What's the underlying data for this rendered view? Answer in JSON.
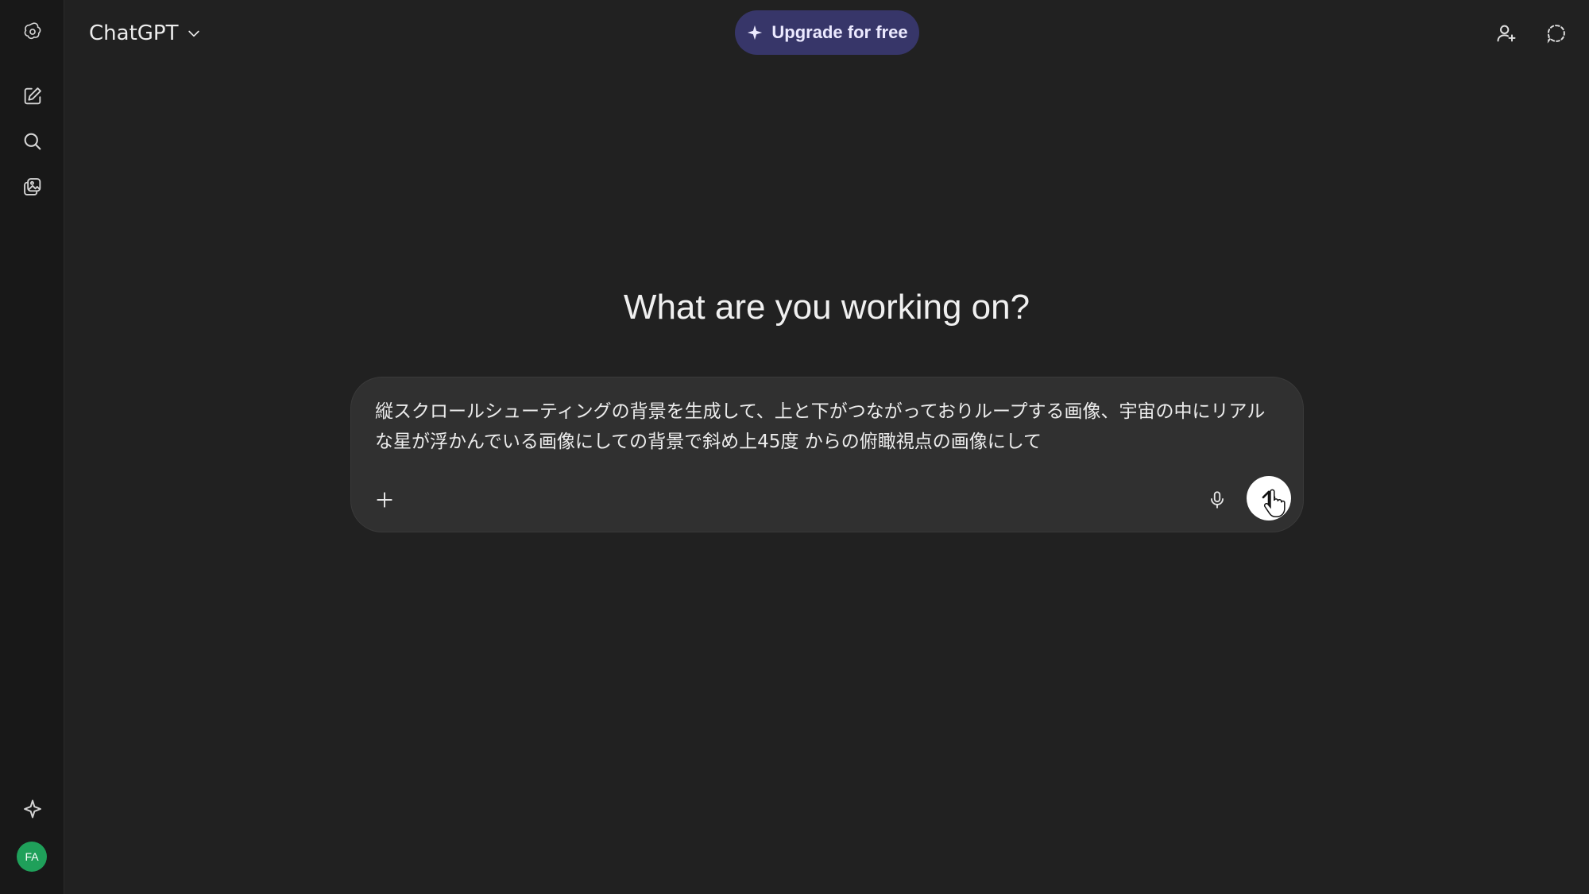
{
  "header": {
    "model_label": "ChatGPT",
    "upgrade_label": "Upgrade for free"
  },
  "main": {
    "headline": "What are you working on?",
    "prompt_text": "縦スクロールシューティングの背景を生成して、上と下がつながっておりループする画像、宇宙の中にリアルな星が浮かんでいる画像にしての背景で斜め上45度 からの俯瞰視点の画像にして"
  },
  "user": {
    "initials": "FA"
  },
  "colors": {
    "background": "#212121",
    "rail": "#181818",
    "composer": "#303030",
    "upgrade_pill": "#373669",
    "avatar": "#1fa05a"
  },
  "icons": {
    "logo": "openai-logo-icon",
    "new_chat": "new-chat-icon",
    "search": "search-icon",
    "library": "library-icon",
    "explore": "sparkle-icon",
    "share": "add-person-icon",
    "temporary": "temporary-chat-icon",
    "attach": "plus-icon",
    "voice": "microphone-icon",
    "send": "arrow-up-icon"
  }
}
